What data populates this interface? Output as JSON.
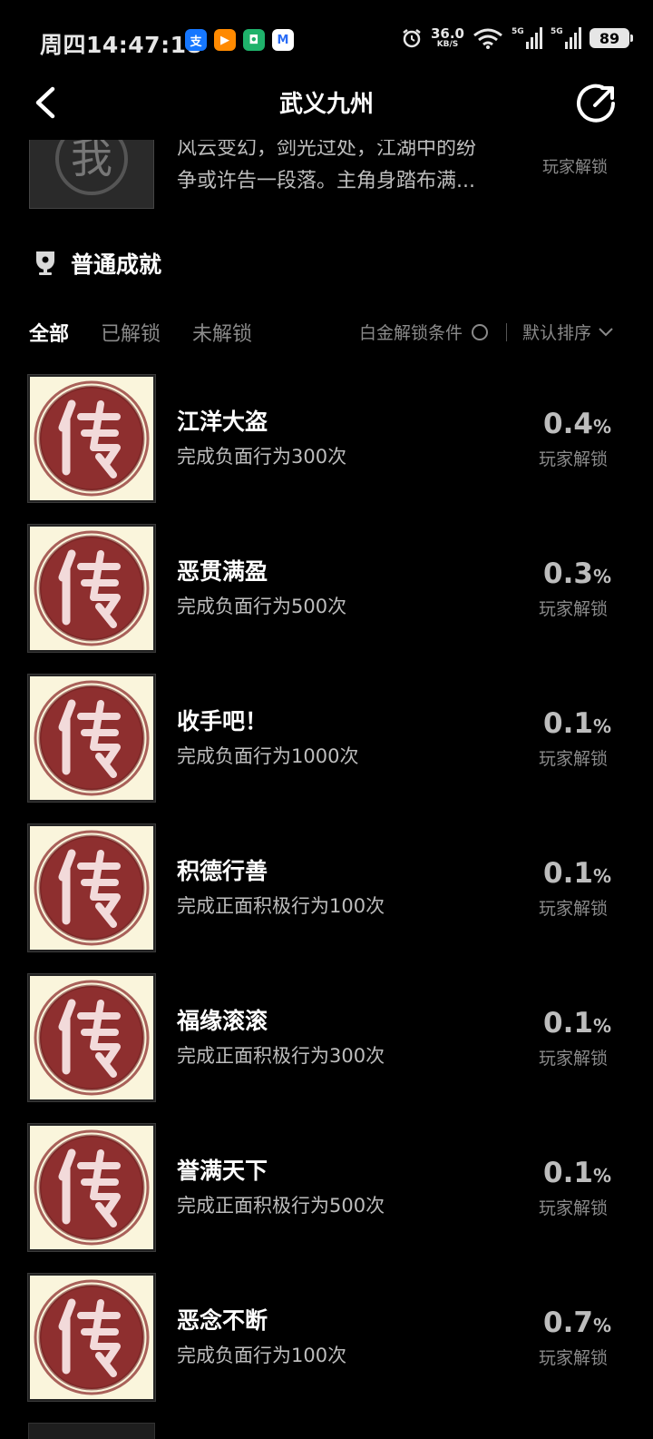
{
  "status_bar": {
    "time": "周四14:47:18",
    "apps": [
      {
        "name": "alipay-icon",
        "glyph": "支",
        "color": "#1677ff"
      },
      {
        "name": "video-app-icon",
        "glyph": "▶",
        "color": "#ff8a00"
      },
      {
        "name": "shield-app-icon",
        "glyph": "◘",
        "color": "#1fb26b"
      },
      {
        "name": "m-app-icon",
        "glyph": "M",
        "color": "#2a6cf6"
      }
    ],
    "net_speed": "36.0",
    "net_unit": "KB/S",
    "sim1": "5G",
    "sim2": "5G",
    "battery": "89"
  },
  "header": {
    "title": "武义九州"
  },
  "prev_item": {
    "desc_line1": "风云变幻，剑光过处，江湖中的纷",
    "desc_line2": "争或许告一段落。主角身踏布满...",
    "unlock_label": "玩家解锁"
  },
  "section": {
    "title": "普通成就"
  },
  "filters": {
    "tab_all": "全部",
    "tab_unlocked": "已解锁",
    "tab_locked": "未解锁",
    "platinum": "白金解锁条件",
    "sort": "默认排序"
  },
  "achievements": [
    {
      "name": "江洋大盗",
      "desc": "完成负面行为300次",
      "pct": "0.4",
      "unit": "%",
      "unlock": "玩家解锁"
    },
    {
      "name": "恶贯满盈",
      "desc": "完成负面行为500次",
      "pct": "0.3",
      "unit": "%",
      "unlock": "玩家解锁"
    },
    {
      "name": "收手吧！",
      "desc": "完成负面行为1000次",
      "pct": "0.1",
      "unit": "%",
      "unlock": "玩家解锁"
    },
    {
      "name": "积德行善",
      "desc": "完成正面积极行为100次",
      "pct": "0.1",
      "unit": "%",
      "unlock": "玩家解锁"
    },
    {
      "name": "福缘滚滚",
      "desc": "完成正面积极行为300次",
      "pct": "0.1",
      "unit": "%",
      "unlock": "玩家解锁"
    },
    {
      "name": "誉满天下",
      "desc": "完成正面积极行为500次",
      "pct": "0.1",
      "unit": "%",
      "unlock": "玩家解锁"
    },
    {
      "name": "恶念不断",
      "desc": "完成负面行为100次",
      "pct": "0.7",
      "unit": "%",
      "unlock": "玩家解锁"
    }
  ],
  "icon_glyph": "传",
  "colors": {
    "seal_red": "#8e2f2f",
    "seal_bg": "#faf5dc"
  }
}
